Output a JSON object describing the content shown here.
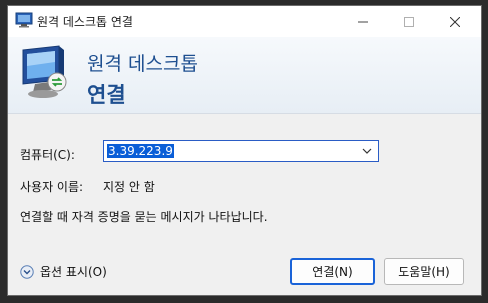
{
  "window": {
    "title": "원격 데스크톱 연결",
    "controls": {
      "minimize_icon": "minimize-icon",
      "maximize_icon": "maximize-icon",
      "close_icon": "close-icon"
    }
  },
  "banner": {
    "line1": "원격 데스크톱",
    "line2": "연결",
    "icon": "remote-desktop-monitor-icon"
  },
  "form": {
    "computer_label": "컴퓨터(C):",
    "computer_value": "3.39.223.9",
    "username_label": "사용자 이름:",
    "username_value": "지정 안 함",
    "info_text": "연결할 때 자격 증명을 묻는 메시지가 나타납니다."
  },
  "footer": {
    "options_label": "옵션 표시(O)",
    "connect_label": "연결(N)",
    "help_label": "도움말(H)"
  },
  "colors": {
    "accent": "#1a63d8",
    "banner_text": "#1e4f90",
    "selection": "#0a5ed7"
  }
}
